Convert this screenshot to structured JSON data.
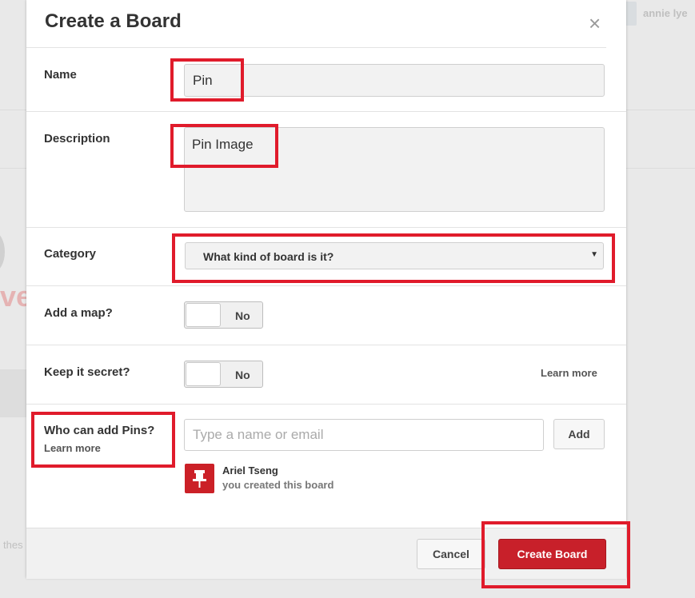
{
  "background": {
    "user_name": "annie lye",
    "left_fragment": "ve",
    "left_word": "thes"
  },
  "modal": {
    "title": "Create a Board",
    "close_icon": "close-icon",
    "close_glyph": "×"
  },
  "form": {
    "name": {
      "label": "Name",
      "value": "Pin"
    },
    "description": {
      "label": "Description",
      "value": "Pin Image"
    },
    "category": {
      "label": "Category",
      "selected": "What kind of board is it?",
      "arrow_glyph": "▼"
    },
    "map": {
      "label": "Add a map?",
      "toggle_state": "No"
    },
    "secret": {
      "label": "Keep it secret?",
      "toggle_state": "No",
      "learn_more": "Learn more"
    },
    "collaborators": {
      "label": "Who can add Pins?",
      "learn_more": "Learn more",
      "placeholder": "Type a name or email",
      "add_button": "Add",
      "owner_name": "Ariel Tseng",
      "owner_sub": "you created this board",
      "owner_icon": "pushpin-icon"
    }
  },
  "footer": {
    "cancel": "Cancel",
    "create": "Create Board"
  },
  "colors": {
    "accent": "#c8202a",
    "annotation": "#e01b2b",
    "page_bg": "#e9e9e9"
  }
}
